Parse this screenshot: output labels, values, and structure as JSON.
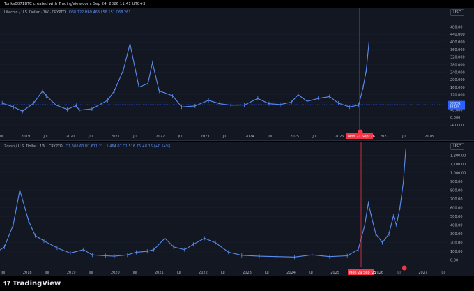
{
  "header": {
    "caption": "Tonks0071BTC created with TradingView.com, Sep 24, 2026 11:41 UTC+3"
  },
  "footer": {
    "brand": "TradingView"
  },
  "colors": {
    "background": "#131722",
    "candle": "#5b8def",
    "crosshair": "#f23645",
    "text": "#b2b5be"
  },
  "chart_data": [
    {
      "type": "line",
      "legend": "Litecoin / U.S. Dollar · 1W · CRYPTO",
      "ohlc": "O68.722  H69.466  L58.151  C68.261",
      "currency": "USD",
      "y_ticks": [
        480,
        440,
        400,
        360,
        320,
        280,
        240,
        200,
        160,
        120,
        80,
        40,
        0,
        -40
      ],
      "y_tick_labels": [
        "480.00",
        "440.000",
        "400.000",
        "360.000",
        "320.000",
        "280.000",
        "240.000",
        "200.000",
        "160.000",
        "120.000",
        "80.000",
        "40.000",
        "0.000",
        "-40.000"
      ],
      "ylim": [
        -55,
        500
      ],
      "x_labels": [
        "Jul",
        "2019",
        "Jul",
        "2020",
        "Jul",
        "2021",
        "Jul",
        "2022",
        "Jul",
        "2023",
        "Jul",
        "2024",
        "Jul",
        "2025",
        "Jul",
        "2026",
        "Jul",
        "2027",
        "Jul",
        "2028"
      ],
      "crosshair_label": "Mon 21 Sep '26",
      "last_price": "68.261",
      "last_price_extra": "3d 18h",
      "series": [
        {
          "x": [
            2018.5,
            2018.75,
            2018.95,
            2019.2,
            2019.4,
            2019.48,
            2019.7,
            2019.95,
            2020.15,
            2020.22,
            2020.5,
            2020.85,
            2021.0,
            2021.2,
            2021.35,
            2021.55,
            2021.75,
            2021.85,
            2022.0,
            2022.3,
            2022.5,
            2022.8,
            2023.1,
            2023.35,
            2023.6,
            2023.9,
            2024.2,
            2024.45,
            2024.7,
            2024.95,
            2025.1,
            2025.3,
            2025.55,
            2025.8,
            2026.0,
            2026.25,
            2026.45,
            2026.55,
            2026.62,
            2026.68
          ],
          "y": [
            75,
            55,
            32,
            75,
            140,
            115,
            65,
            42,
            62,
            38,
            45,
            90,
            140,
            250,
            390,
            160,
            180,
            290,
            140,
            115,
            55,
            60,
            90,
            72,
            64,
            65,
            100,
            72,
            68,
            80,
            120,
            85,
            100,
            110,
            75,
            55,
            65,
            160,
            250,
            400
          ]
        }
      ]
    },
    {
      "type": "line",
      "legend": "Zcash / U.S. Dollar · 1W · CRYPTO",
      "ohlc": "O1,506.60  H1,671.21  L1,464.07  C1,516.76",
      "change": "+8.16 (+0.54%)",
      "currency": "USD",
      "y_ticks": [
        1200,
        1100,
        1000,
        900,
        800,
        700,
        600,
        500,
        400,
        300,
        200,
        100,
        0
      ],
      "y_tick_labels": [
        "1,200.00",
        "1,100.00",
        "1,000.00",
        "900.00",
        "800.00",
        "700.00",
        "600.00",
        "500.00",
        "400.00",
        "300.00",
        "200.00",
        "100.00",
        "0.00"
      ],
      "ylim": [
        -50,
        1290
      ],
      "x_labels": [
        "Jul",
        "2018",
        "Jul",
        "2019",
        "Jul",
        "2020",
        "Jul",
        "2021",
        "Jul",
        "2022",
        "Jul",
        "2023",
        "Jul",
        "2024",
        "Jul",
        "2025",
        "Jul",
        "2026",
        "Jul",
        "2027",
        "Jul"
      ],
      "crosshair_label": "Mon 29 Sep '25",
      "series": [
        {
          "x": [
            2017.3,
            2017.6,
            2017.8,
            2017.95,
            2018.15,
            2018.3,
            2018.5,
            2018.8,
            2019.1,
            2019.4,
            2019.6,
            2019.9,
            2020.1,
            2020.4,
            2020.6,
            2020.85,
            2021.0,
            2021.25,
            2021.45,
            2021.7,
            2021.9,
            2022.15,
            2022.4,
            2022.7,
            2023.0,
            2023.4,
            2023.8,
            2024.2,
            2024.6,
            2025.0,
            2025.4,
            2025.65,
            2025.8,
            2025.88,
            2025.95,
            2026.05,
            2026.2,
            2026.35,
            2026.45,
            2026.52,
            2026.6,
            2026.68,
            2026.73
          ],
          "y": [
            50,
            150,
            400,
            800,
            450,
            280,
            220,
            140,
            80,
            120,
            60,
            50,
            45,
            60,
            90,
            100,
            120,
            250,
            150,
            120,
            180,
            250,
            200,
            90,
            55,
            45,
            40,
            35,
            60,
            40,
            50,
            120,
            400,
            650,
            500,
            300,
            200,
            300,
            500,
            400,
            600,
            900,
            1250
          ]
        }
      ]
    }
  ]
}
